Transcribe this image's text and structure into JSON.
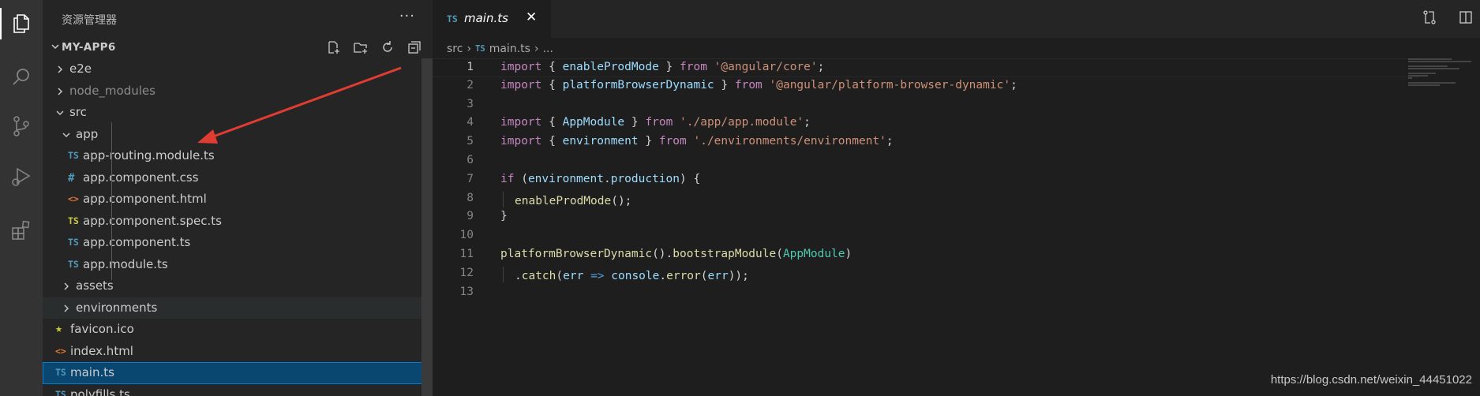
{
  "activity_bar": {
    "items": [
      {
        "icon": "files-icon",
        "active": true
      },
      {
        "icon": "search-icon",
        "active": false
      },
      {
        "icon": "source-control-icon",
        "active": false
      },
      {
        "icon": "run-debug-icon",
        "active": false
      },
      {
        "icon": "extensions-icon",
        "active": false
      }
    ]
  },
  "sidebar": {
    "title": "资源管理器",
    "more_icon": "···",
    "section_label": "MY-APP6",
    "section_actions": [
      "new-file-icon",
      "new-folder-icon",
      "refresh-icon",
      "collapse-all-icon"
    ],
    "tree": [
      {
        "name": "e2e",
        "kind": "folder",
        "expanded": false,
        "depth": 0
      },
      {
        "name": "node_modules",
        "kind": "folder",
        "expanded": false,
        "depth": 0,
        "dimmed": true
      },
      {
        "name": "src",
        "kind": "folder",
        "expanded": true,
        "depth": 0
      },
      {
        "name": "app",
        "kind": "folder",
        "expanded": true,
        "depth": 1
      },
      {
        "name": "app-routing.module.ts",
        "kind": "ts",
        "icon_text": "TS",
        "depth": 2
      },
      {
        "name": "app.component.css",
        "kind": "css",
        "icon_text": "#",
        "depth": 2
      },
      {
        "name": "app.component.html",
        "kind": "html",
        "icon_text": "<>",
        "depth": 2
      },
      {
        "name": "app.component.spec.ts",
        "kind": "ts-spec",
        "icon_text": "TS",
        "depth": 2
      },
      {
        "name": "app.component.ts",
        "kind": "ts",
        "icon_text": "TS",
        "depth": 2
      },
      {
        "name": "app.module.ts",
        "kind": "ts",
        "icon_text": "TS",
        "depth": 2
      },
      {
        "name": "assets",
        "kind": "folder",
        "expanded": false,
        "depth": 1
      },
      {
        "name": "environments",
        "kind": "folder",
        "expanded": false,
        "depth": 1,
        "hover": true
      },
      {
        "name": "favicon.ico",
        "kind": "ico",
        "icon_text": "★",
        "depth": 1
      },
      {
        "name": "index.html",
        "kind": "html",
        "icon_text": "<>",
        "depth": 1
      },
      {
        "name": "main.ts",
        "kind": "ts",
        "icon_text": "TS",
        "depth": 1,
        "selected": true
      },
      {
        "name": "polyfills.ts",
        "kind": "ts",
        "icon_text": "TS",
        "depth": 1
      }
    ]
  },
  "editor": {
    "tab": {
      "icon_text": "TS",
      "name": "main.ts",
      "close": "✕"
    },
    "tab_actions": [
      "compare-changes-icon",
      "split-editor-icon"
    ],
    "breadcrumb": {
      "folder": "src",
      "file_icon_text": "TS",
      "file": "main.ts",
      "tail": "..."
    },
    "lines": [
      {
        "n": "1",
        "current": true,
        "tokens": [
          [
            "k",
            "import"
          ],
          [
            "p",
            " { "
          ],
          [
            "v",
            "enableProdMode"
          ],
          [
            "p",
            " } "
          ],
          [
            "k",
            "from"
          ],
          [
            "p",
            " "
          ],
          [
            "s",
            "'@angular/core'"
          ],
          [
            "p",
            ";"
          ]
        ]
      },
      {
        "n": "2",
        "tokens": [
          [
            "k",
            "import"
          ],
          [
            "p",
            " { "
          ],
          [
            "v",
            "platformBrowserDynamic"
          ],
          [
            "p",
            " } "
          ],
          [
            "k",
            "from"
          ],
          [
            "p",
            " "
          ],
          [
            "s",
            "'@angular/platform-browser-dynamic'"
          ],
          [
            "p",
            ";"
          ]
        ]
      },
      {
        "n": "3",
        "tokens": []
      },
      {
        "n": "4",
        "tokens": [
          [
            "k",
            "import"
          ],
          [
            "p",
            " { "
          ],
          [
            "v",
            "AppModule"
          ],
          [
            "p",
            " } "
          ],
          [
            "k",
            "from"
          ],
          [
            "p",
            " "
          ],
          [
            "s",
            "'./app/app.module'"
          ],
          [
            "p",
            ";"
          ]
        ]
      },
      {
        "n": "5",
        "tokens": [
          [
            "k",
            "import"
          ],
          [
            "p",
            " { "
          ],
          [
            "v",
            "environment"
          ],
          [
            "p",
            " } "
          ],
          [
            "k",
            "from"
          ],
          [
            "p",
            " "
          ],
          [
            "s",
            "'./environments/environment'"
          ],
          [
            "p",
            ";"
          ]
        ]
      },
      {
        "n": "6",
        "tokens": []
      },
      {
        "n": "7",
        "tokens": [
          [
            "k",
            "if"
          ],
          [
            "p",
            " ("
          ],
          [
            "v",
            "environment"
          ],
          [
            "p",
            "."
          ],
          [
            "v",
            "production"
          ],
          [
            "p",
            ") {"
          ]
        ]
      },
      {
        "n": "8",
        "indent": true,
        "tokens": [
          [
            "f",
            "enableProdMode"
          ],
          [
            "p",
            "();"
          ]
        ]
      },
      {
        "n": "9",
        "tokens": [
          [
            "p",
            "}"
          ]
        ]
      },
      {
        "n": "10",
        "tokens": []
      },
      {
        "n": "11",
        "tokens": [
          [
            "f",
            "platformBrowserDynamic"
          ],
          [
            "p",
            "()."
          ],
          [
            "f",
            "bootstrapModule"
          ],
          [
            "p",
            "("
          ],
          [
            "c",
            "AppModule"
          ],
          [
            "p",
            ")"
          ]
        ]
      },
      {
        "n": "12",
        "indent": true,
        "tokens": [
          [
            "p",
            "."
          ],
          [
            "f",
            "catch"
          ],
          [
            "p",
            "("
          ],
          [
            "v",
            "err"
          ],
          [
            "p",
            " "
          ],
          [
            "kw",
            "=>"
          ],
          [
            "p",
            " "
          ],
          [
            "v",
            "console"
          ],
          [
            "p",
            "."
          ],
          [
            "f",
            "error"
          ],
          [
            "p",
            "("
          ],
          [
            "v",
            "err"
          ],
          [
            "p",
            "));"
          ]
        ]
      },
      {
        "n": "13",
        "tokens": []
      }
    ]
  },
  "watermark": "https://blog.csdn.net/weixin_44451022",
  "colors": {
    "accent": "#007fd4",
    "selection": "#094771",
    "ts_icon": "#519aba",
    "annotation_arrow": "#e03c31"
  }
}
